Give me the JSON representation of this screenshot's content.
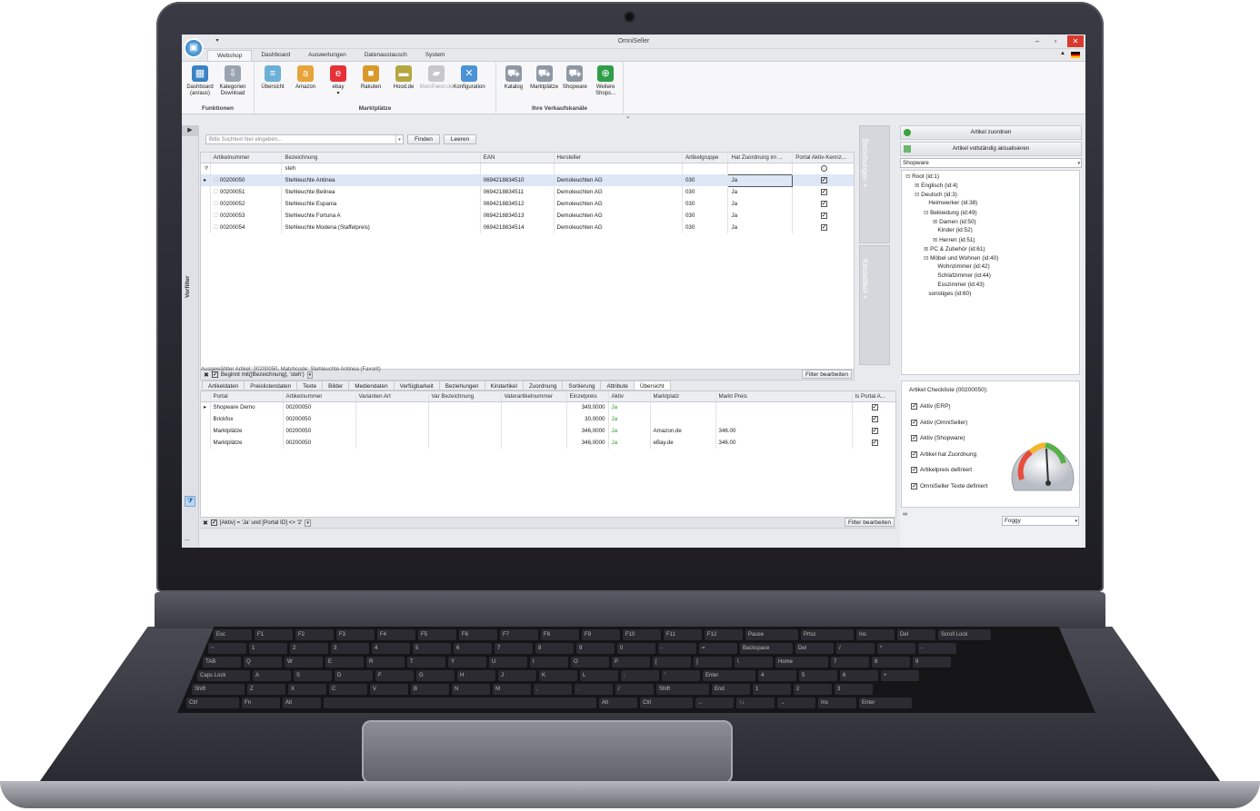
{
  "app": {
    "title": "OmniSeller"
  },
  "tabs": [
    "Webshop",
    "Dashboard",
    "Auswertungen",
    "Datenaustausch",
    "System"
  ],
  "ribbon": {
    "groups": [
      {
        "label": "Funktionen",
        "buttons": [
          {
            "l1": "Dashboard",
            "l2": "(an/aus)",
            "icon": "dashboard-icon"
          },
          {
            "l1": "Kategorien",
            "l2": "Download",
            "icon": "download-icon"
          }
        ]
      },
      {
        "label": "Marktplätze",
        "buttons": [
          {
            "l1": "Übersicht",
            "l2": "",
            "icon": "overview-icon"
          },
          {
            "l1": "Amazon",
            "l2": "",
            "icon": "amazon-icon"
          },
          {
            "l1": "ebay",
            "l2": "▾",
            "icon": "ebay-icon"
          },
          {
            "l1": "Rakuten",
            "l2": "",
            "icon": "box-icon"
          },
          {
            "l1": "Hood.de",
            "l2": "",
            "icon": "hood-icon"
          },
          {
            "l1": "MeinPaket.de",
            "l2": "",
            "icon": "truck-icon"
          },
          {
            "l1": "Konfiguration",
            "l2": "",
            "icon": "tools-icon"
          }
        ]
      },
      {
        "label": "Ihre Verkaufskanäle",
        "buttons": [
          {
            "l1": "Katalog",
            "l2": "",
            "icon": "cart-icon"
          },
          {
            "l1": "Marktplätze",
            "l2": "",
            "icon": "cart-icon"
          },
          {
            "l1": "Shopware",
            "l2": "",
            "icon": "cart-icon"
          },
          {
            "l1": "Weitere",
            "l2": "Shops...",
            "icon": "globe-add-icon"
          }
        ]
      }
    ]
  },
  "search": {
    "placeholder": "Bitte Suchtext hier eingeben...",
    "find": "Finden",
    "clear": "Leeren"
  },
  "leftbar": {
    "label": "Vorfilter"
  },
  "grid": {
    "columns": [
      "Artikelnummer",
      "Bezeichnung",
      "EAN",
      "Hersteller",
      "Artikelgruppe",
      "Hat Zuordnung im ...",
      "Portal Aktiv-Kennz..."
    ],
    "filter_value": "steh",
    "rows": [
      [
        "00200050",
        "Stehleuchte Antinea",
        "0694218834510",
        "Demoleuchten AG",
        "030",
        "Ja"
      ],
      [
        "00200051",
        "Stehleuchte Belinea",
        "0694218834511",
        "Demoleuchten AG",
        "030",
        "Ja"
      ],
      [
        "00200052",
        "Stehleuchte Espania",
        "0694218834512",
        "Demoleuchten AG",
        "030",
        "Ja"
      ],
      [
        "00200053",
        "Stehleuchte Fortuna A",
        "0694218834513",
        "Demoleuchten AG",
        "030",
        "Ja"
      ],
      [
        "00200054",
        "Stehleuchte Modena (Staffelpreis)",
        "0694218834514",
        "Demoleuchten AG",
        "030",
        "Ja"
      ]
    ],
    "filter_text": "Beginnt mit([Bezeichnung], 'steh')",
    "filter_edit": "Filter bearbeiten"
  },
  "side_buttons": [
    "Beziehungen +",
    "Kindartikel +"
  ],
  "selected_info": "Ausgewählter Artikel: 00200050, Matchcode: Stehleuchte Antinea (Favorit)",
  "detail_tabs": [
    "Artikeldaten",
    "Preislistendaten",
    "Texte",
    "Bilder",
    "Mediendaten",
    "Verfügbarkeit",
    "Beziehungen",
    "Kindartikel",
    "Zuordnung",
    "Sortierung",
    "Attribute",
    "Übersicht"
  ],
  "detail": {
    "columns": [
      "Portal",
      "Artikelnummer",
      "Varianten Art",
      "Var Bezeichnung",
      "Vaterartikelnummer",
      "Einzelpreis",
      "Aktiv",
      "Marktplatz",
      "Markt Preis",
      "Is Portal A..."
    ],
    "rows": [
      [
        "Shopware Demo",
        "00200050",
        "",
        "",
        "",
        "349,0000",
        "Ja",
        "",
        ""
      ],
      [
        "Brickfox",
        "00200050",
        "",
        "",
        "",
        "30,0000",
        "Ja",
        "",
        ""
      ],
      [
        "Marktplätze",
        "00200050",
        "",
        "",
        "",
        "346,0000",
        "Ja",
        "Amazon.de",
        "346.00"
      ],
      [
        "Marktplätze",
        "00200050",
        "",
        "",
        "",
        "346,0000",
        "Ja",
        "eBay.de",
        "346.00"
      ]
    ],
    "filter_text": "[Aktiv] = 'Ja' und [Portal ID] <> '2'",
    "filter_edit": "Filter bearbeiten"
  },
  "right": {
    "assign": "Artikel zuordnen",
    "update": "Artikel vollständig aktualisieren",
    "shop": "Shopware",
    "tree": [
      {
        "t": "Root (id:1)",
        "d": 0,
        "x": "⊟"
      },
      {
        "t": "Englisch (id:4)",
        "d": 1,
        "x": "⊞"
      },
      {
        "t": "Deutsch (id:3)",
        "d": 1,
        "x": "⊟"
      },
      {
        "t": "Heimwerker (id:38)",
        "d": 2,
        "x": ""
      },
      {
        "t": "Bekleidung (id:49)",
        "d": 2,
        "x": "⊟"
      },
      {
        "t": "Damen (id:50)",
        "d": 3,
        "x": "⊞"
      },
      {
        "t": "Kinder (id:52)",
        "d": 3,
        "x": ""
      },
      {
        "t": "Herren (id:51)",
        "d": 3,
        "x": "⊞"
      },
      {
        "t": "PC & Zubehör (id:61)",
        "d": 2,
        "x": "⊞"
      },
      {
        "t": "Möbel und Wohnen (id:40)",
        "d": 2,
        "x": "⊟"
      },
      {
        "t": "Wohnzimmer (id:42)",
        "d": 3,
        "x": ""
      },
      {
        "t": "Schlafzimmer (id:44)",
        "d": 3,
        "x": ""
      },
      {
        "t": "Esszimmer (id:43)",
        "d": 3,
        "x": ""
      },
      {
        "t": "sonstiges (id:60)",
        "d": 2,
        "x": ""
      }
    ],
    "checklist_title": "Artikel Checkliste (00200050):",
    "checklist": [
      "Aktiv (ERP)",
      "Aktiv (OmniSeller)",
      "Aktiv (Shopware)",
      "Artikel hat Zuordnung",
      "Artikelpreis definiert",
      "OmniSeller Texte definiert"
    ],
    "theme": "Foggy"
  },
  "keyboard": {
    "row1": [
      "Esc",
      "F1",
      "F2",
      "F3",
      "F4",
      "F5",
      "F6",
      "F7",
      "F8",
      "F9",
      "F10",
      "F11",
      "F12",
      "Pause",
      "Prtsc",
      "Ins",
      "Del",
      "Scroll Lock"
    ],
    "row2": [
      "~",
      "1",
      "2",
      "3",
      "4",
      "5",
      "6",
      "7",
      "8",
      "9",
      "0",
      "-",
      "=",
      "Backspace",
      "Del",
      "/",
      "*",
      "-"
    ],
    "row3": [
      "TAB",
      "Q",
      "W",
      "E",
      "R",
      "T",
      "Y",
      "U",
      "I",
      "O",
      "P",
      "[",
      "]",
      "\\",
      "Home",
      "7",
      "8",
      "9"
    ],
    "row4": [
      "Caps Lock",
      "A",
      "S",
      "D",
      "F",
      "G",
      "H",
      "J",
      "K",
      "L",
      ";",
      "'",
      "Enter",
      "4",
      "5",
      "6",
      "+"
    ],
    "row5": [
      "Shift",
      "Z",
      "X",
      "C",
      "V",
      "B",
      "N",
      "M",
      ",",
      ".",
      "/",
      "Shift",
      "End",
      "1",
      "2",
      "3"
    ],
    "row6": [
      "Ctrl",
      "Fn",
      "Alt",
      "",
      "Alt",
      "Ctrl",
      "←",
      "↑↓",
      "→",
      "Ins",
      "Enter"
    ]
  }
}
